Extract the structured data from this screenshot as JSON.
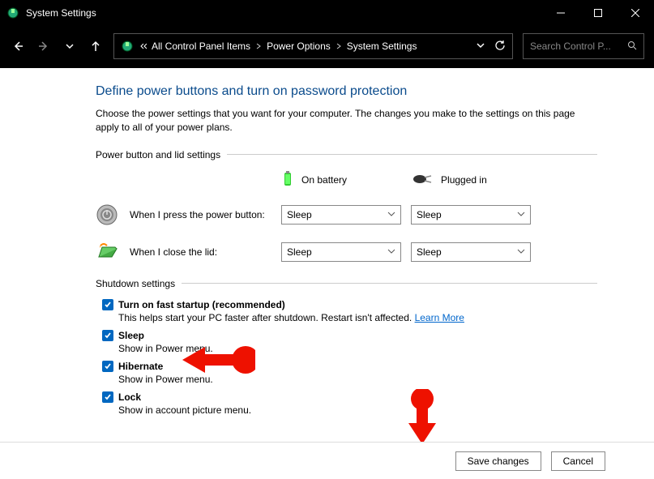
{
  "window": {
    "title": "System Settings"
  },
  "breadcrumb": {
    "items": [
      "All Control Panel Items",
      "Power Options",
      "System Settings"
    ]
  },
  "search": {
    "placeholder": "Search Control P..."
  },
  "page": {
    "title": "Define power buttons and turn on password protection",
    "description": "Choose the power settings that you want for your computer. The changes you make to the settings on this page apply to all of your power plans."
  },
  "sections": {
    "power_button": {
      "header": "Power button and lid settings",
      "col_battery": "On battery",
      "col_plugged": "Plugged in",
      "rows": [
        {
          "label": "When I press the power button:",
          "battery": "Sleep",
          "plugged": "Sleep"
        },
        {
          "label": "When I close the lid:",
          "battery": "Sleep",
          "plugged": "Sleep"
        }
      ]
    },
    "shutdown": {
      "header": "Shutdown settings",
      "items": [
        {
          "label": "Turn on fast startup (recommended)",
          "desc_pre": "This helps start your PC faster after shutdown. Restart isn't affected. ",
          "link": "Learn More",
          "checked": true
        },
        {
          "label": "Sleep",
          "desc": "Show in Power menu.",
          "checked": true
        },
        {
          "label": "Hibernate",
          "desc": "Show in Power menu.",
          "checked": true
        },
        {
          "label": "Lock",
          "desc": "Show in account picture menu.",
          "checked": true
        }
      ]
    }
  },
  "footer": {
    "save": "Save changes",
    "cancel": "Cancel"
  }
}
